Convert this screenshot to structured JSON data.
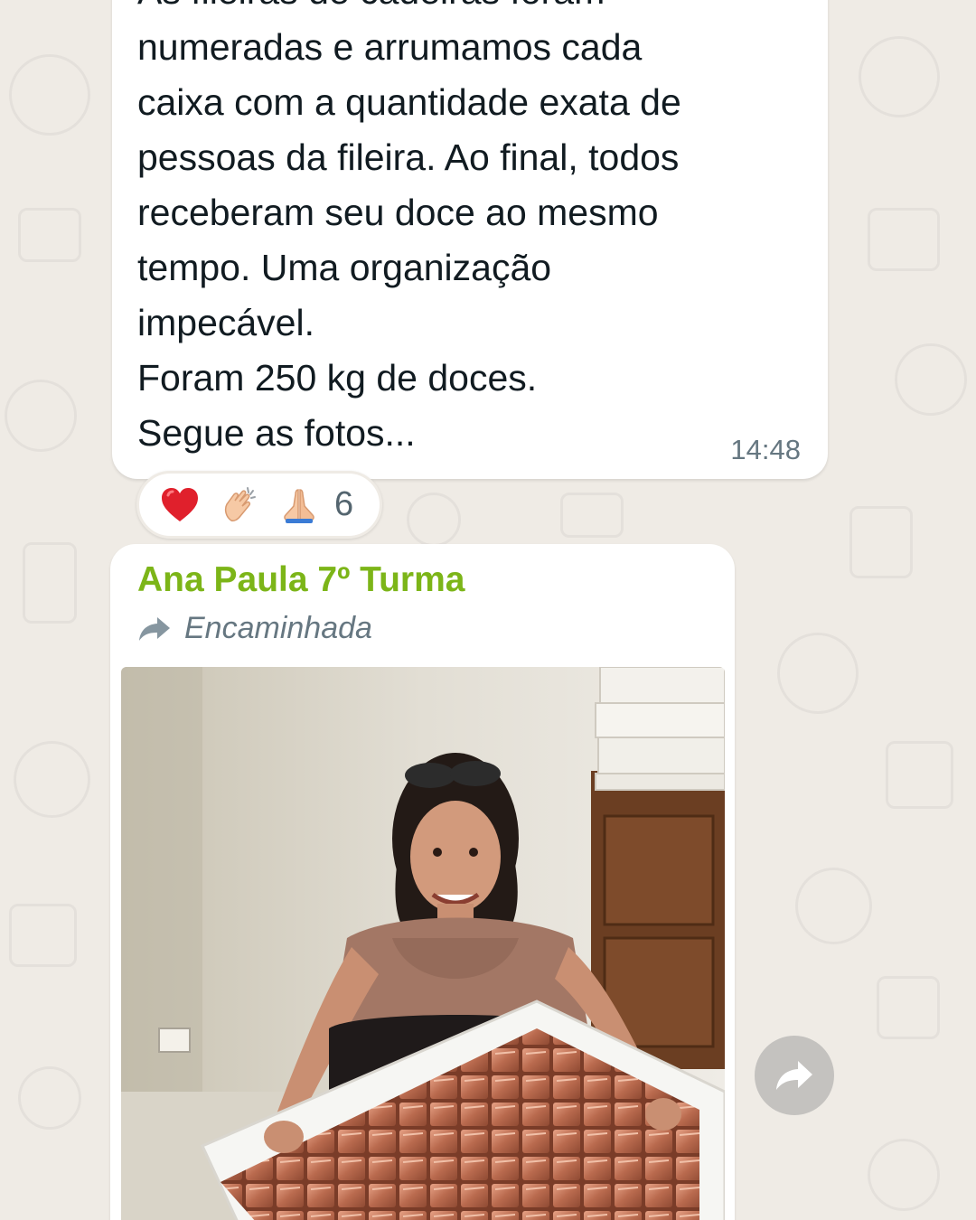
{
  "message": {
    "lines": [
      "As fileiras de cadeiras foram",
      "numeradas e arrumamos cada",
      "caixa com a quantidade exata de",
      "pessoas da fileira. Ao final, todos",
      "receberam seu doce ao mesmo",
      "tempo. Uma organização",
      "impecável.",
      "Foram 250 kg de doces.",
      "Segue as fotos..."
    ],
    "time": "14:48"
  },
  "reactions": {
    "emojis": [
      "heart-icon",
      "clapping-hands-icon",
      "folded-hands-icon"
    ],
    "count": "6"
  },
  "image_message": {
    "sender": "Ana Paula 7º Turma",
    "sender_color": "#7cb518",
    "forwarded_label": "Encaminhada",
    "photo_icon": "photo-of-woman-with-box-of-sweets"
  },
  "forward_button_icon": "forward-arrow-icon",
  "colors": {
    "wallpaper": "#efebe5",
    "bubble": "#ffffff",
    "text": "#111b21",
    "meta": "#667781"
  }
}
